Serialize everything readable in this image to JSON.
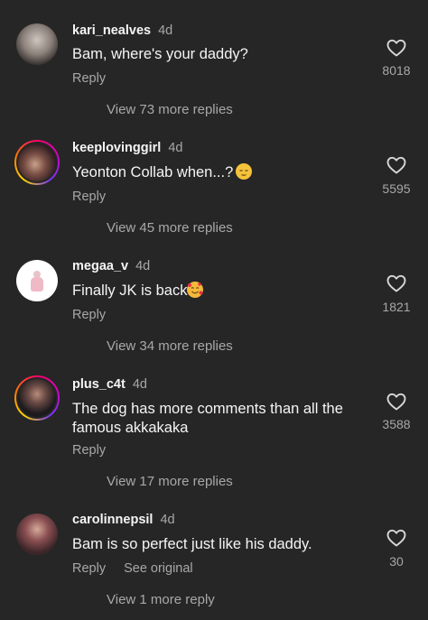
{
  "comments": [
    {
      "username": "kari_nealves",
      "time": "4d",
      "text": "Bam, where's your daddy?",
      "emoji": "",
      "reply": "Reply",
      "see_original": "",
      "likes": "8018",
      "view_more": "View 73 more replies"
    },
    {
      "username": "keeplovinggirl",
      "time": "4d",
      "text": "Yeonton Collab when...?",
      "emoji": "relieved-face",
      "reply": "Reply",
      "see_original": "",
      "likes": "5595",
      "view_more": "View 45 more replies"
    },
    {
      "username": "megaa_v",
      "time": "4d",
      "text": "Finally JK is back",
      "emoji": "smiling-face-with-hearts",
      "reply": "Reply",
      "see_original": "",
      "likes": "1821",
      "view_more": "View 34 more replies"
    },
    {
      "username": "plus_c4t",
      "time": "4d",
      "text": "The dog has more comments than all the famous akkakaka",
      "emoji": "",
      "reply": "Reply",
      "see_original": "",
      "likes": "3588",
      "view_more": "View 17 more replies"
    },
    {
      "username": "carolinnepsil",
      "time": "4d",
      "text": "Bam is so perfect just like his daddy.",
      "emoji": "",
      "reply": "Reply",
      "see_original": "See original",
      "likes": "30",
      "view_more": "View 1 more reply"
    }
  ],
  "icons": {
    "like": "heart-outline-icon"
  },
  "colors": {
    "background": "#262626",
    "primary_text": "#f5f5f5",
    "secondary_text": "#a8a8a8",
    "story_ring": "#d300c5"
  }
}
